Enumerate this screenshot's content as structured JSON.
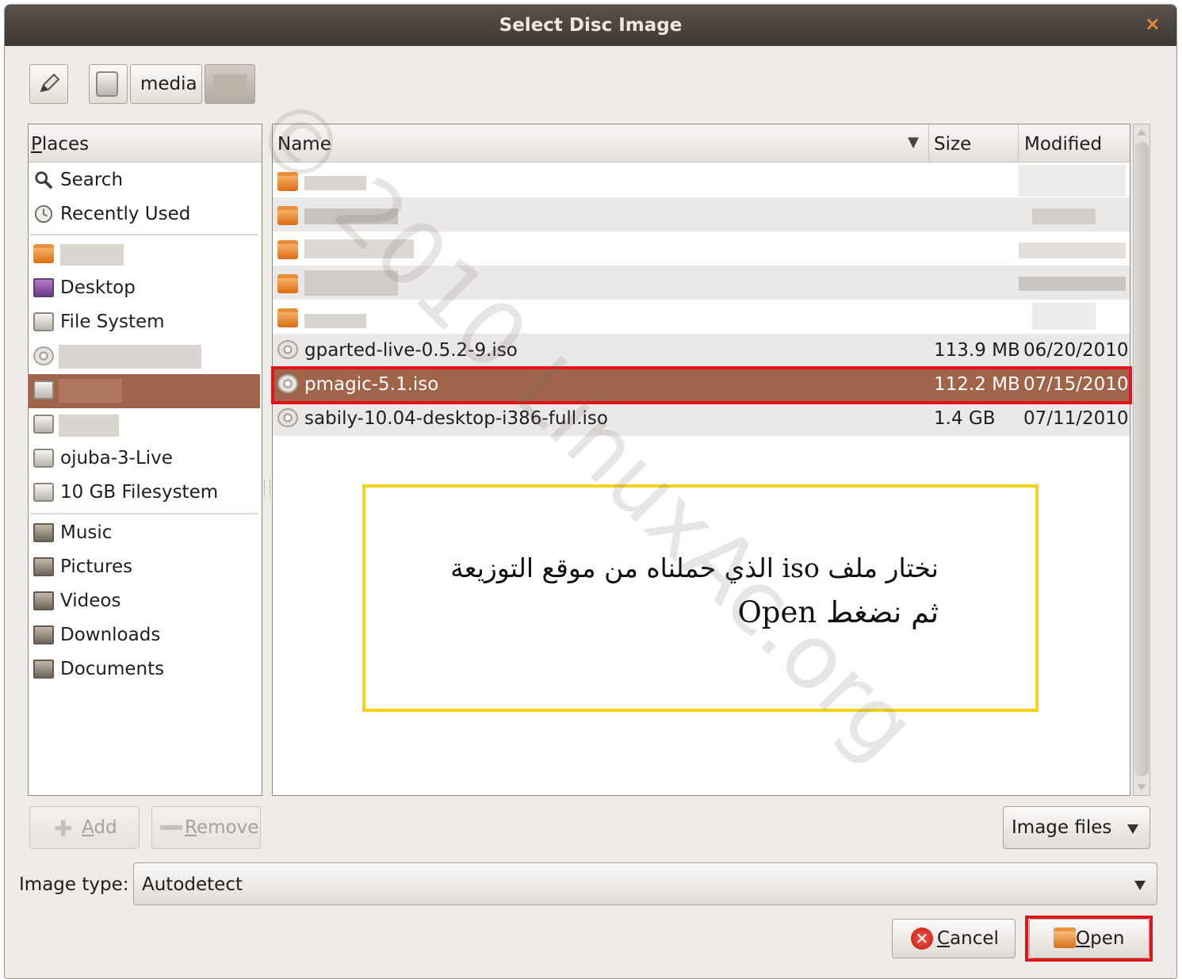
{
  "window": {
    "title": "Select Disc Image",
    "close_glyph": "×"
  },
  "toolbar": {
    "edit_icon": "pencil-icon",
    "path_segment": "media"
  },
  "places": {
    "header": "Places",
    "header_mnemonic": "P",
    "header_rest": "laces",
    "items": [
      {
        "label": "Search",
        "icon": "search-icon"
      },
      {
        "label": "Recently Used",
        "icon": "clock-icon"
      },
      {
        "label": "",
        "icon": "home-folder-icon",
        "redacted": true
      },
      {
        "label": "Desktop",
        "icon": "desktop-icon"
      },
      {
        "label": "File System",
        "icon": "drive-icon"
      },
      {
        "label": "",
        "icon": "disc-icon",
        "redacted": true
      },
      {
        "label": "",
        "icon": "drive-icon",
        "redacted": true,
        "selected": true
      },
      {
        "label": "",
        "icon": "drive-icon",
        "redacted": true
      },
      {
        "label": "ojuba-3-Live",
        "icon": "drive-icon"
      },
      {
        "label": "10 GB Filesystem",
        "icon": "drive-icon"
      },
      {
        "label": "Music",
        "icon": "music-folder-icon"
      },
      {
        "label": "Pictures",
        "icon": "pictures-folder-icon"
      },
      {
        "label": "Videos",
        "icon": "videos-folder-icon"
      },
      {
        "label": "Downloads",
        "icon": "downloads-folder-icon"
      },
      {
        "label": "Documents",
        "icon": "documents-folder-icon"
      }
    ],
    "add_label": "Add",
    "add_mnemonic": "A",
    "add_rest": "dd",
    "remove_label": "Remove",
    "remove_mnemonic": "R",
    "remove_rest": "emove"
  },
  "files": {
    "columns": {
      "name": "Name",
      "size": "Size",
      "modified": "Modified",
      "sort_glyph": "▼"
    },
    "iso_rows": [
      {
        "name": "gparted-live-0.5.2-9.iso",
        "size": "113.9 MB",
        "modified": "06/20/2010",
        "selected": false
      },
      {
        "name": "pmagic-5.1.iso",
        "size": "112.2 MB",
        "modified": "07/15/2010",
        "selected": true
      },
      {
        "name": "sabily-10.04-desktop-i386-full.iso",
        "size": "1.4 GB",
        "modified": "07/11/2010",
        "selected": false
      }
    ],
    "filter_label": "Image files"
  },
  "annotation": {
    "line1": "نختار ملف iso الذي حملناه من موقع التوزيعة",
    "line2": "ثم نضغط Open"
  },
  "watermark": "© 2010 LinuxAc.org",
  "image_type": {
    "label": "Image type:",
    "value": "Autodetect"
  },
  "actions": {
    "cancel_label": "Cancel",
    "cancel_mnemonic": "C",
    "cancel_rest": "ancel",
    "open_label": "Open",
    "open_mnemonic": "O",
    "open_rest": "pen"
  },
  "colors": {
    "selection": "#a0644b",
    "highlight_red": "#e3131b",
    "annotation_yellow": "#f4d21e",
    "titlebar": "#4a433d",
    "dialog_bg": "#efebe7"
  }
}
